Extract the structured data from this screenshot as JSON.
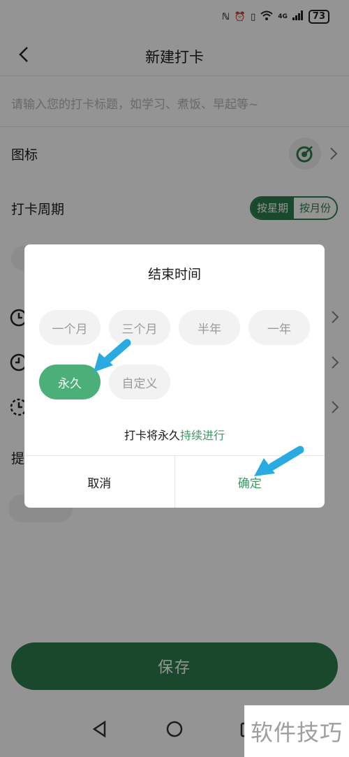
{
  "status_bar": {
    "network": "4G",
    "battery": "73"
  },
  "header": {
    "title": "新建打卡"
  },
  "title_input": {
    "placeholder": "请输入您的打卡标题，如学习、煮饭、早起等~"
  },
  "icon_row": {
    "label": "图标"
  },
  "period_row": {
    "label": "打卡周期",
    "options": [
      "按星期",
      "按月份"
    ],
    "selected": "按星期"
  },
  "remind_row": {
    "label": "提"
  },
  "save_button": {
    "label": "保存"
  },
  "dialog": {
    "title": "结束时间",
    "options": [
      "一个月",
      "三个月",
      "半年",
      "一年",
      "永久",
      "自定义"
    ],
    "selected": "永久",
    "message_prefix": "打卡将永久",
    "message_highlight": "持续进行",
    "cancel_label": "取消",
    "confirm_label": "确定"
  },
  "watermark": {
    "text": "软件技巧"
  },
  "colors": {
    "primary": "#2e7d4f",
    "selected_option": "#4caf7a",
    "accent_text": "#3a9a63",
    "arrow": "#29abe2"
  }
}
